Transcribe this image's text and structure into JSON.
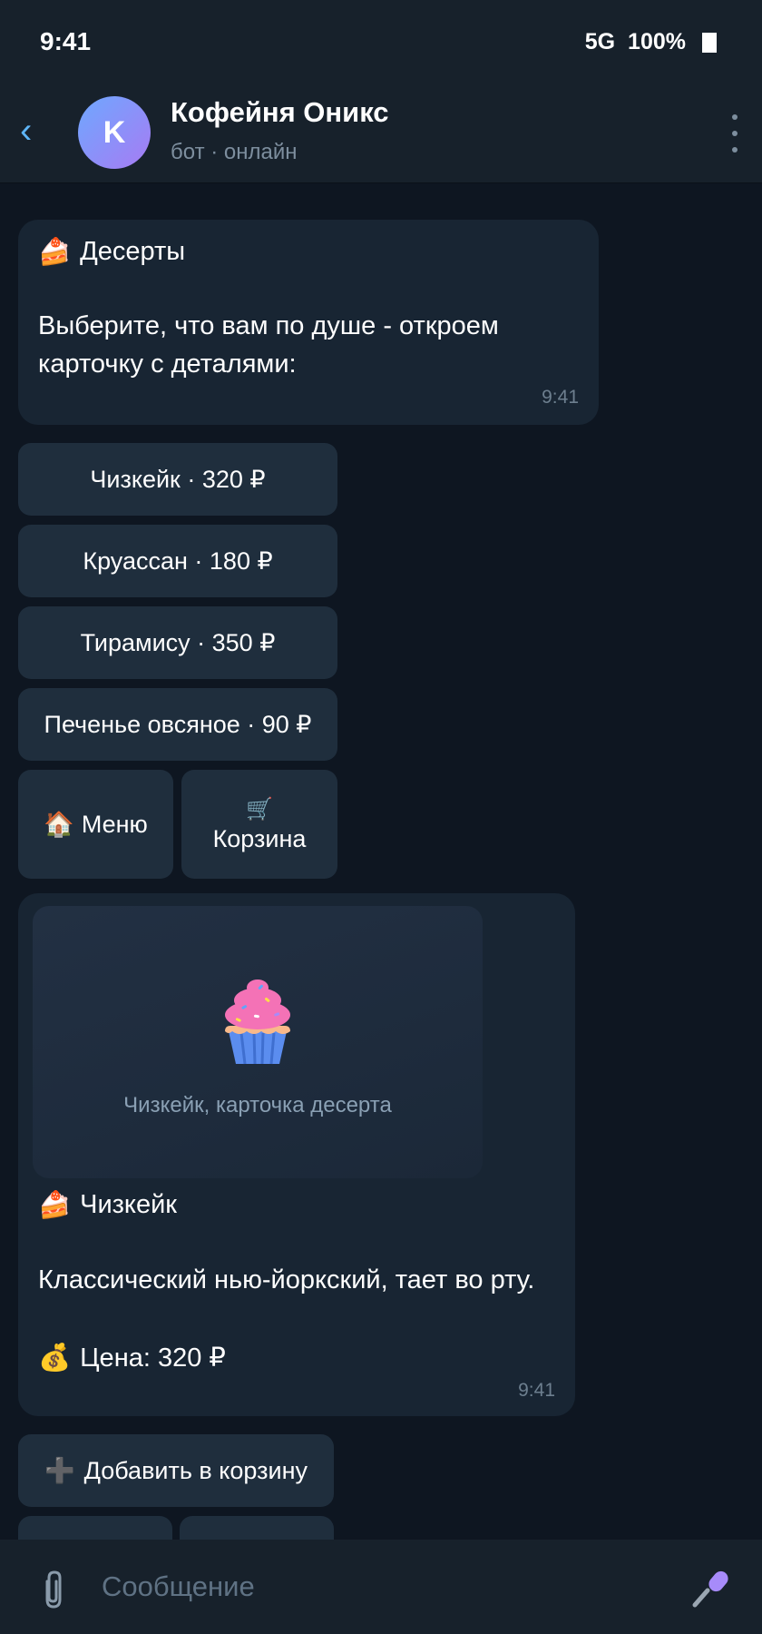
{
  "status": {
    "time": "9:41",
    "network": "5G",
    "battery": "100%"
  },
  "header": {
    "avatar_letter": "K",
    "title": "Кофейня Оникс",
    "subtitle": "бот · онлайн"
  },
  "messages": {
    "m1": {
      "emoji": "🍰",
      "title": "Десерты",
      "body": "Выберите, что вам по душе - откроем карточку с деталями:",
      "time": "9:41"
    },
    "keyboard1": [
      {
        "label": "Чизкейк · 320 ₽"
      },
      {
        "label": "Круассан · 180 ₽"
      },
      {
        "label": "Тирамису · 350 ₽"
      },
      {
        "label": "Печенье овсяное · 90 ₽"
      }
    ],
    "nav": {
      "menu_emoji": "🏠",
      "menu_label": "Меню",
      "cart_emoji": "🛒",
      "cart_label": "Корзина"
    },
    "m2": {
      "photo_caption": "Чизкейк, карточка десерта",
      "title_emoji": "🍰",
      "title": "Чизкейк",
      "description": "Классический нью-йоркский, тает во рту.",
      "price_emoji": "💰",
      "price": "Цена: 320 ₽",
      "time": "9:41"
    },
    "keyboard2": {
      "add_emoji": "➕",
      "add_label": "Добавить в корзину"
    }
  },
  "input": {
    "placeholder": "Сообщение"
  },
  "colors": {
    "background": "#0e1621",
    "bubble": "#182533",
    "button": "#1f2e3d",
    "accent": "#5eb5f7"
  }
}
